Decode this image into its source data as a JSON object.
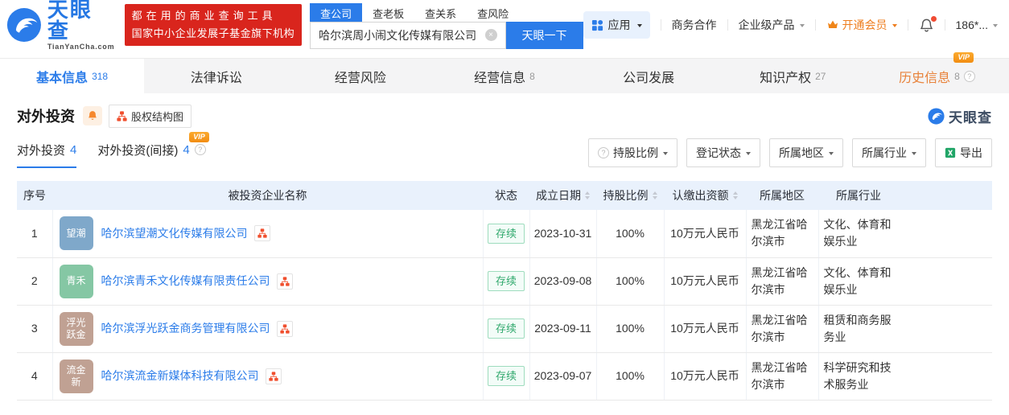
{
  "brand": {
    "name": "天眼查",
    "domain": "TianYanCha.com"
  },
  "promo": {
    "line1": "都在用的商业查询工具",
    "line2": "国家中小企业发展子基金旗下机构"
  },
  "search": {
    "tabs": [
      {
        "label": "查公司",
        "active": true
      },
      {
        "label": "查老板",
        "active": false
      },
      {
        "label": "查关系",
        "active": false
      },
      {
        "label": "查风险",
        "active": false
      }
    ],
    "value": "哈尔滨周小闹文化传媒有限公司",
    "button_label": "天眼一下"
  },
  "header_menu": {
    "apps": "应用",
    "cooperation": "商务合作",
    "enterprise": "企业级产品",
    "vip": "开通会员",
    "phone": "186*..."
  },
  "badges": {
    "vip": "VIP"
  },
  "nav_tabs": [
    {
      "label": "基本信息",
      "count": "318",
      "active": true
    },
    {
      "label": "法律诉讼",
      "count": "",
      "active": false
    },
    {
      "label": "经营风险",
      "count": "",
      "active": false
    },
    {
      "label": "经营信息",
      "count": "8",
      "active": false
    },
    {
      "label": "公司发展",
      "count": "",
      "active": false
    },
    {
      "label": "知识产权",
      "count": "27",
      "active": false
    },
    {
      "label": "历史信息",
      "count": "8",
      "active": false,
      "vip": true
    }
  ],
  "section": {
    "title": "对外投资",
    "equity_chart_label": "股权结构图",
    "watermark": "天眼查",
    "subtabs": [
      {
        "label": "对外投资",
        "count": "4",
        "active": true
      },
      {
        "label": "对外投资(间接)",
        "count": "4",
        "active": false,
        "vip": true
      }
    ],
    "filters": {
      "holding_ratio": "持股比例",
      "registration_status": "登记状态",
      "region": "所属地区",
      "industry": "所属行业",
      "export_label": "导出"
    }
  },
  "colors": {
    "accent_blue": "#2b7ce9",
    "brand_red": "#d9251d",
    "vip_orange": "#f59b22",
    "status_green": "#2fa86c",
    "table_header_bg": "#e9f1fc"
  },
  "table": {
    "columns": [
      {
        "label": "序号",
        "sortable": false
      },
      {
        "label": "被投资企业名称",
        "sortable": false
      },
      {
        "label": "状态",
        "sortable": false
      },
      {
        "label": "成立日期",
        "sortable": true
      },
      {
        "label": "持股比例",
        "sortable": true
      },
      {
        "label": "认缴出资额",
        "sortable": true
      },
      {
        "label": "所属地区",
        "sortable": false
      },
      {
        "label": "所属行业",
        "sortable": false
      }
    ],
    "rows": [
      {
        "index": "1",
        "avatar_lines": [
          "望潮"
        ],
        "avatar_color": "#7fa8ca",
        "name": "哈尔滨望潮文化传媒有限公司",
        "status": "存续",
        "date": "2023-10-31",
        "ratio": "100%",
        "capital": "10万元人民币",
        "region": "黑龙江省哈尔滨市",
        "industry": "文化、体育和娱乐业"
      },
      {
        "index": "2",
        "avatar_lines": [
          "青禾"
        ],
        "avatar_color": "#85c7a4",
        "name": "哈尔滨青禾文化传媒有限责任公司",
        "status": "存续",
        "date": "2023-09-08",
        "ratio": "100%",
        "capital": "10万元人民币",
        "region": "黑龙江省哈尔滨市",
        "industry": "文化、体育和娱乐业"
      },
      {
        "index": "3",
        "avatar_lines": [
          "浮光",
          "跃金"
        ],
        "avatar_color": "#c0a193",
        "name": "哈尔滨浮光跃金商务管理有限公司",
        "status": "存续",
        "date": "2023-09-11",
        "ratio": "100%",
        "capital": "10万元人民币",
        "region": "黑龙江省哈尔滨市",
        "industry": "租赁和商务服务业"
      },
      {
        "index": "4",
        "avatar_lines": [
          "流金",
          "新"
        ],
        "avatar_color": "#c0a193",
        "name": "哈尔滨流金新媒体科技有限公司",
        "status": "存续",
        "date": "2023-09-07",
        "ratio": "100%",
        "capital": "10万元人民币",
        "region": "黑龙江省哈尔滨市",
        "industry": "科学研究和技术服务业"
      }
    ]
  }
}
